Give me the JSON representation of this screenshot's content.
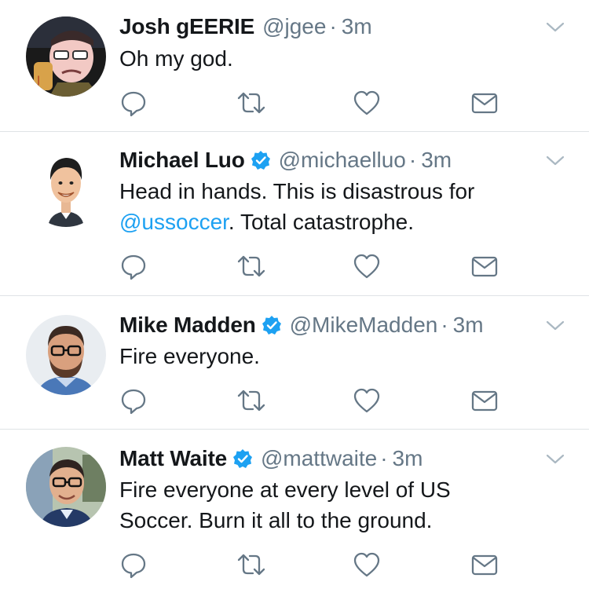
{
  "colors": {
    "text": "#14171a",
    "secondary": "#657786",
    "link": "#1da1f2",
    "verified": "#1da1f2",
    "icon": "#657786",
    "divider": "#dfe3e6"
  },
  "tweets": [
    {
      "name": "Josh gEERIE",
      "handle": "@jgee",
      "dot": "·",
      "time": "3m",
      "verified": false,
      "text_lines": [
        "Oh my god."
      ],
      "avatar_icon": "cartoon-avatar"
    },
    {
      "name": "Michael Luo",
      "handle": "@michaelluo",
      "dot": "·",
      "time": "3m",
      "verified": true,
      "text_lines": [
        "Head in hands. This is disastrous for"
      ],
      "mention": "@ussoccer",
      "after_mention": ". Total catastrophe.",
      "avatar_icon": "illustrated-avatar"
    },
    {
      "name": "Mike Madden",
      "handle": "@MikeMadden",
      "dot": "·",
      "time": "3m",
      "verified": true,
      "text_lines": [
        "Fire everyone."
      ],
      "avatar_icon": "photo-avatar"
    },
    {
      "name": "Matt Waite",
      "handle": "@mattwaite",
      "dot": "·",
      "time": "3m",
      "verified": true,
      "text_lines": [
        "Fire everyone at every level of US",
        "Soccer. Burn it all to the ground."
      ],
      "avatar_icon": "photo-avatar"
    }
  ],
  "actions": [
    "reply-icon",
    "retweet-icon",
    "like-icon",
    "direct-message-icon"
  ],
  "menu_icon": "chevron-down-icon",
  "verified_icon": "verified-badge-icon"
}
